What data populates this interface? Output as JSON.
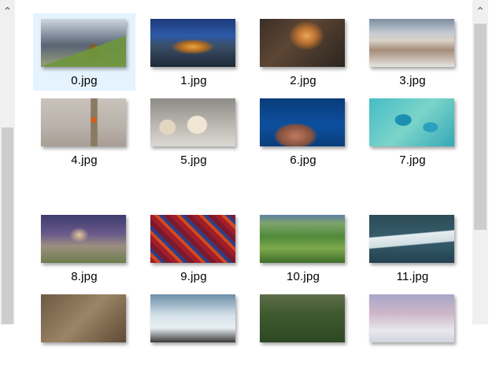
{
  "files": [
    {
      "name": "0.jpg",
      "selected": true
    },
    {
      "name": "1.jpg"
    },
    {
      "name": "2.jpg"
    },
    {
      "name": "3.jpg"
    },
    {
      "name": "4.jpg"
    },
    {
      "name": "5.jpg"
    },
    {
      "name": "6.jpg"
    },
    {
      "name": "7.jpg"
    },
    {
      "name": "8.jpg"
    },
    {
      "name": "9.jpg"
    },
    {
      "name": "10.jpg"
    },
    {
      "name": "11.jpg"
    },
    {
      "name": ""
    },
    {
      "name": ""
    },
    {
      "name": ""
    },
    {
      "name": ""
    }
  ],
  "icons": {
    "scroll_up": "chevron-up-icon"
  }
}
